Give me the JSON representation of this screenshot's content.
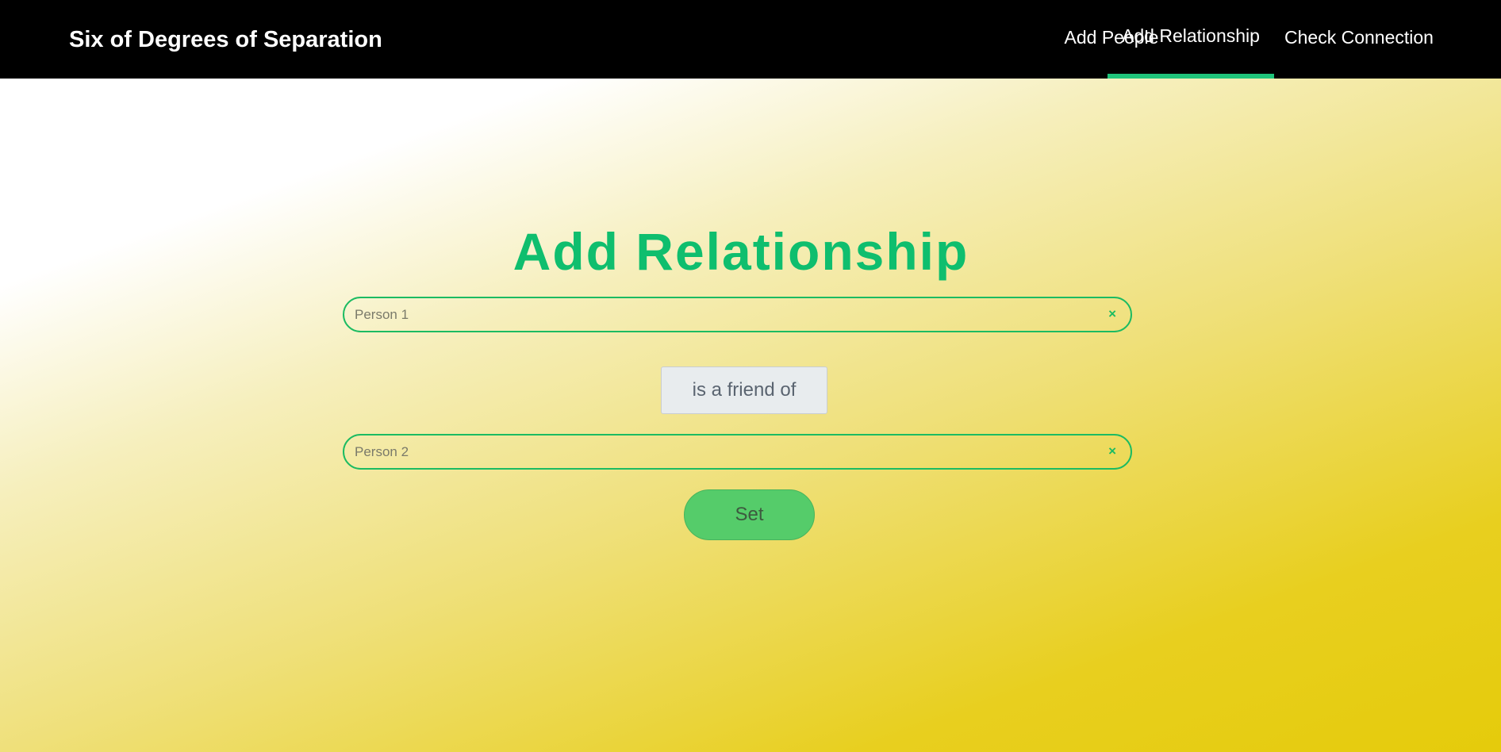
{
  "navbar": {
    "brand": "Six of Degrees of Separation",
    "links": [
      {
        "label": "Add People",
        "active": false
      },
      {
        "label": "Add Relationship",
        "active": true
      },
      {
        "label": "Check Connection",
        "active": false
      }
    ]
  },
  "main": {
    "title": "Add Relationship",
    "person1": {
      "placeholder": "Person 1",
      "value": "",
      "clear": "×"
    },
    "relation": "is a friend of",
    "person2": {
      "placeholder": "Person 2",
      "value": "",
      "clear": "×"
    },
    "submit_label": "Set"
  },
  "colors": {
    "navbar_bg": "#000000",
    "accent": "#0fbe6e",
    "active_underline": "#1fc47a",
    "button_bg": "#55cc6a"
  }
}
